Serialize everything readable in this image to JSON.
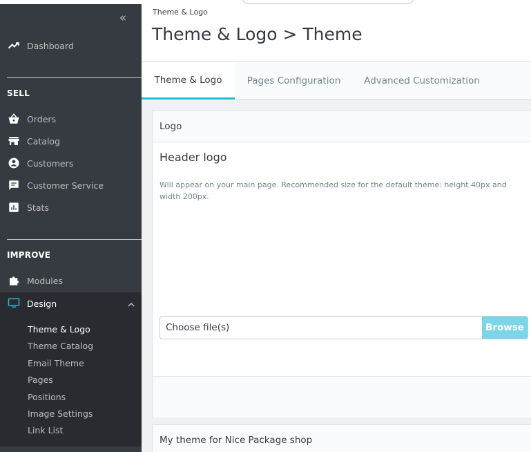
{
  "sidebar": {
    "collapse_glyph": "«",
    "dashboard": "Dashboard",
    "sections": {
      "sell": "SELL",
      "improve": "IMPROVE"
    },
    "sell_items": [
      "Orders",
      "Catalog",
      "Customers",
      "Customer Service",
      "Stats"
    ],
    "modules": "Modules",
    "design": "Design",
    "design_sub": [
      "Theme & Logo",
      "Theme Catalog",
      "Email Theme",
      "Pages",
      "Positions",
      "Image Settings",
      "Link List"
    ],
    "accent_color": "#25b9d7"
  },
  "header": {
    "breadcrumb": "Theme & Logo",
    "title": "Theme & Logo > Theme"
  },
  "tabs": [
    "Theme & Logo",
    "Pages Configuration",
    "Advanced Customization"
  ],
  "logo_card": {
    "header": "Logo",
    "field_title": "Header logo",
    "help": "Will appear on your main page. Recommended size for the default theme: height 40px and width 200px.",
    "file_placeholder": "Choose file(s)",
    "browse_label": "Browse"
  },
  "theme_card": {
    "header": "My theme for Nice Package shop"
  }
}
